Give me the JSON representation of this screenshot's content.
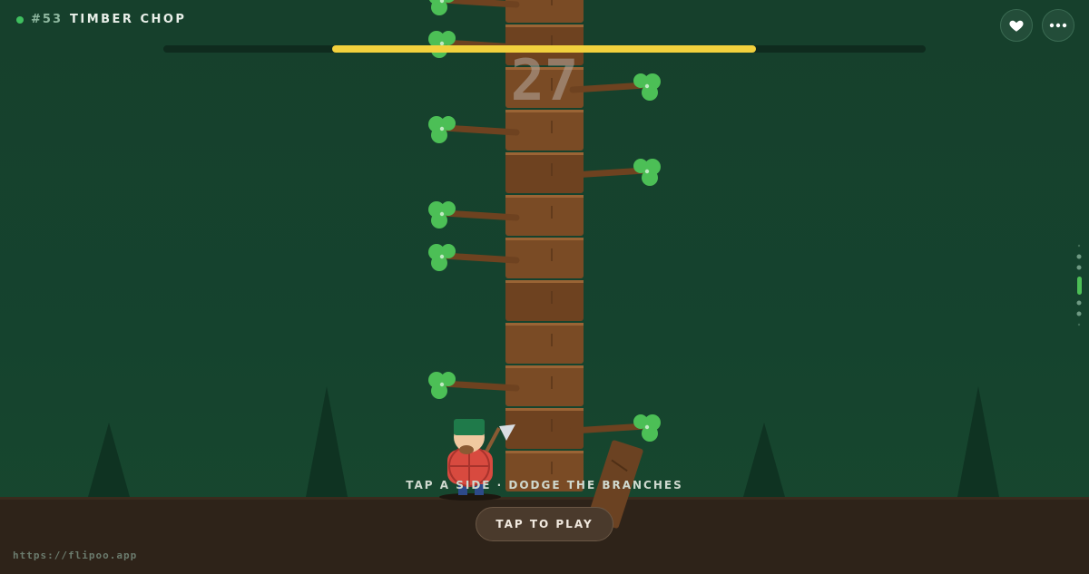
{
  "header": {
    "game_number": "#53",
    "game_title": "TIMBER CHOP"
  },
  "controls": {
    "like_icon": "heart-icon",
    "menu_icon": "more-horizontal-icon"
  },
  "timer": {
    "progress": 0.556
  },
  "score": "27",
  "tree": {
    "segments": 11,
    "branches": [
      "left",
      "left",
      "right",
      "left",
      "right",
      "left",
      "left",
      "none",
      "none",
      "left",
      "right"
    ]
  },
  "hint": "TAP A SIDE · DODGE THE BRANCHES",
  "play_button": "TAP TO PLAY",
  "footer": {
    "url": "https://flipoo.app"
  },
  "colors": {
    "background": "#16402c",
    "timer": "#f2d13d",
    "bark": "#7a4b25",
    "leaf": "#4cbf56",
    "ground": "#2e2319",
    "shirt": "#d84a3f",
    "cap": "#1f7a4a"
  }
}
